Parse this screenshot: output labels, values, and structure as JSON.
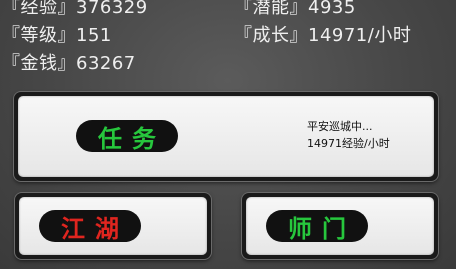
{
  "stats": {
    "experience": {
      "label": "『经验』",
      "value": "376329"
    },
    "potential": {
      "label": "『潜能』",
      "value": "4935"
    },
    "level": {
      "label": "『等级』",
      "value": "151"
    },
    "growth": {
      "label": "『成长』",
      "value": "14971/小时"
    },
    "money": {
      "label": "『金钱』",
      "value": "63267"
    }
  },
  "task_panel": {
    "button_label": "任务",
    "status_line": "平安巡城中...",
    "rate_line": "14971经验/小时"
  },
  "jianghu_button": {
    "label": "江湖"
  },
  "shimen_button": {
    "label": "师门"
  },
  "colors": {
    "green_text": "#27c73d",
    "red_text": "#e0251f",
    "background": "#474747"
  }
}
